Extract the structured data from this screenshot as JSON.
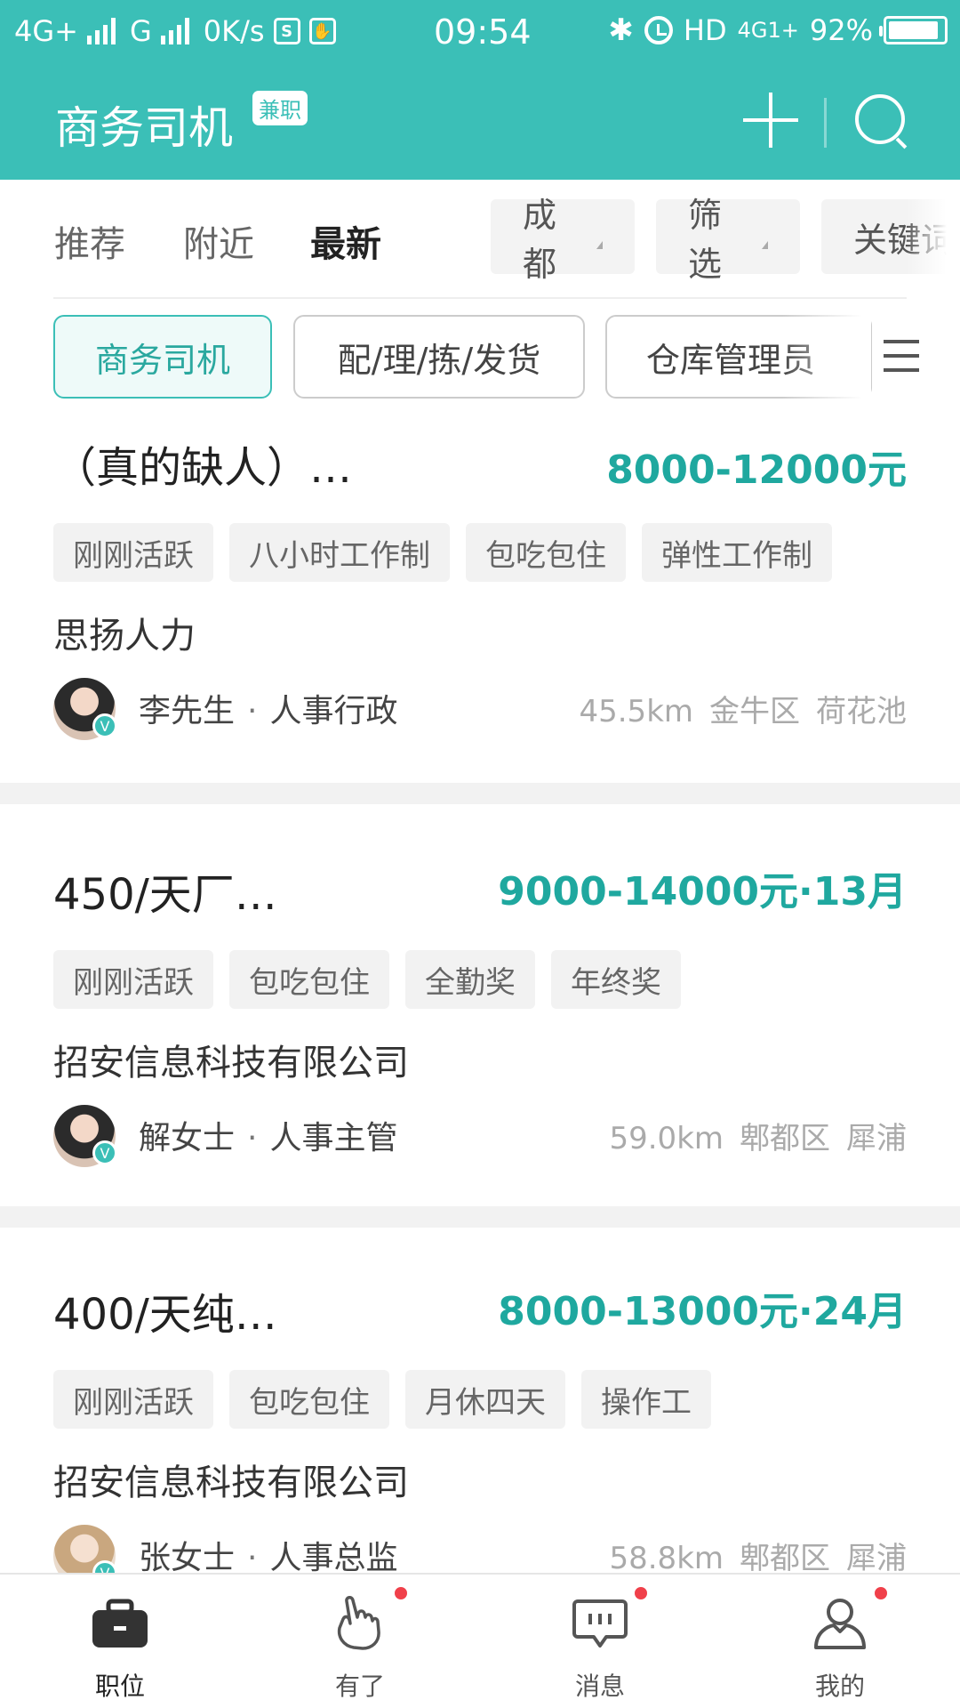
{
  "status_bar": {
    "network1": "4G+",
    "network2": "G",
    "speed": "0K/s",
    "time": "09:54",
    "hd": "HD",
    "network3": "4G1+",
    "battery": "92%",
    "battery_level": 0.92
  },
  "header": {
    "title": "商务司机",
    "badge": "兼职"
  },
  "tabs": {
    "items": [
      "推荐",
      "附近",
      "最新"
    ],
    "active": "最新",
    "city": "成都",
    "filter": "筛选",
    "keyword": "关键词"
  },
  "categories": {
    "items": [
      "商务司机",
      "配/理/拣/发货",
      "仓库管理员"
    ],
    "active": "商务司机"
  },
  "jobs": [
    {
      "title": "（真的缺人）…",
      "salary": "8000-12000元",
      "tags": [
        "刚刚活跃",
        "八小时工作制",
        "包吃包住",
        "弹性工作制"
      ],
      "company": "思扬人力",
      "contact_name": "李先生",
      "contact_role": "人事行政",
      "distance": "45.5km",
      "district": "金牛区",
      "area": "荷花池"
    },
    {
      "title": "450/天厂…",
      "salary": "9000-14000元·13月",
      "tags": [
        "刚刚活跃",
        "包吃包住",
        "全勤奖",
        "年终奖"
      ],
      "company": "招安信息科技有限公司",
      "contact_name": "解女士",
      "contact_role": "人事主管",
      "distance": "59.0km",
      "district": "郫都区",
      "area": "犀浦"
    },
    {
      "title": "400/天纯…",
      "salary": "8000-13000元·24月",
      "tags": [
        "刚刚活跃",
        "包吃包住",
        "月休四天",
        "操作工"
      ],
      "company": "招安信息科技有限公司",
      "contact_name": "张女士",
      "contact_role": "人事总监",
      "distance": "58.8km",
      "district": "郫都区",
      "area": "犀浦"
    }
  ],
  "verify_mark": "V",
  "separator": "·",
  "bottom_nav": {
    "items": [
      {
        "label": "职位",
        "icon": "briefcase-icon",
        "badge": false
      },
      {
        "label": "有了",
        "icon": "hand-icon",
        "badge": true
      },
      {
        "label": "消息",
        "icon": "message-icon",
        "badge": true
      },
      {
        "label": "我的",
        "icon": "profile-icon",
        "badge": true
      }
    ],
    "active": "职位"
  },
  "colors": {
    "brand": "#3bbfb7",
    "salary": "#1fa89f",
    "badge_red": "#f0404a"
  }
}
